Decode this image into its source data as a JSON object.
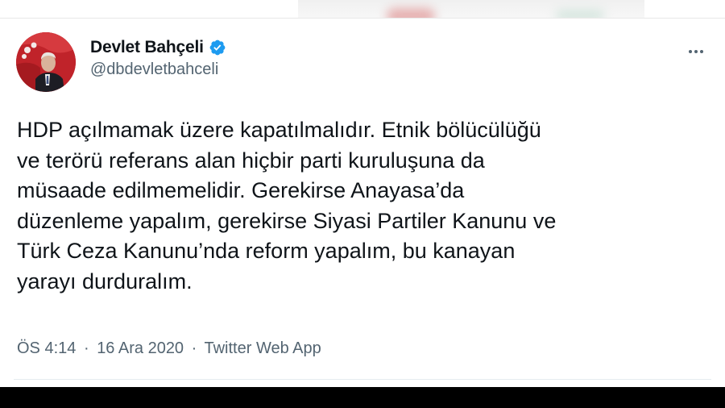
{
  "tweet": {
    "author": {
      "display_name": "Devlet Bahçeli",
      "handle": "@dbdevletbahceli",
      "verified": true,
      "verified_icon": "verified-badge-icon",
      "avatar_icon": "profile-photo"
    },
    "more_icon": "more-options-icon",
    "text_lines": [
      "HDP açılmamak üzere kapatılmalıdır. Etnik bölücülüğü",
      "ve terörü referans alan hiçbir parti kuruluşuna da",
      "müsaade edilmemelidir. Gerekirse Anayasa’da",
      "düzenleme yapalım, gerekirse Siyasi Partiler Kanunu ve",
      "Türk Ceza Kanunu’nda reform yapalım, bu kanayan",
      "yarayı durduralım."
    ],
    "time": "ÖS 4:14",
    "date": "16 Ara 2020",
    "separator": "·",
    "source": "Twitter Web App"
  },
  "colors": {
    "text_primary": "#0f1419",
    "text_secondary": "#536471",
    "verified_blue": "#1d9bf0",
    "avatar_red": "#b81e24"
  }
}
